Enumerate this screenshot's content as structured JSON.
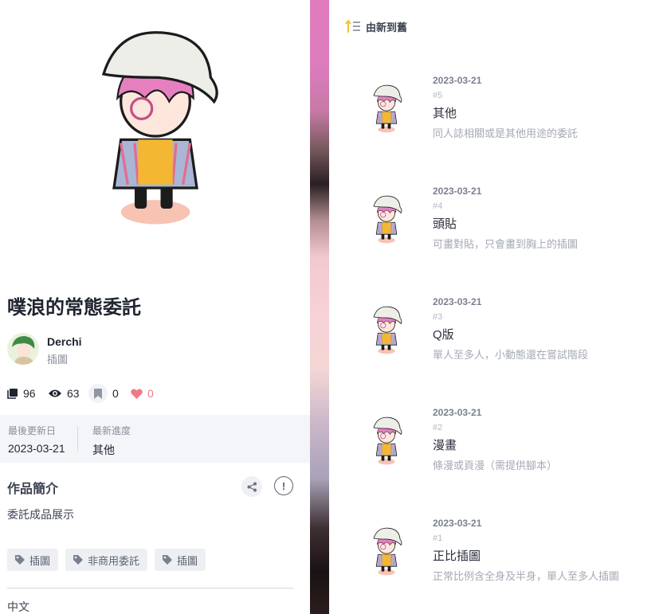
{
  "work": {
    "title": "噗浪的常態委託",
    "author_name": "Derchi",
    "author_role": "插圖",
    "stats": {
      "pages": "96",
      "views": "63",
      "bookmarks": "0",
      "likes": "0"
    },
    "last_update_label": "最後更新日",
    "last_update_value": "2023-03-21",
    "latest_progress_label": "最新進度",
    "latest_progress_value": "其他",
    "synopsis_title": "作品簡介",
    "synopsis": "委託成品展示",
    "report_symbol": "!",
    "tags": [
      "插圖",
      "非商用委託",
      "插圖"
    ],
    "language": "中文"
  },
  "chapters_panel": {
    "sort_label": "由新到舊",
    "chapters": [
      {
        "date": "2023-03-21",
        "number": "#5",
        "title": "其他",
        "desc": "同人誌相關或是其他用途的委託"
      },
      {
        "date": "2023-03-21",
        "number": "#4",
        "title": "頭貼",
        "desc": "可畫對貼，只會畫到胸上的插圖"
      },
      {
        "date": "2023-03-21",
        "number": "#3",
        "title": "Q版",
        "desc": "單人至多人，小動態還在嘗試階段"
      },
      {
        "date": "2023-03-21",
        "number": "#2",
        "title": "漫畫",
        "desc": "條漫或頁漫（需提供腳本）"
      },
      {
        "date": "2023-03-21",
        "number": "#1",
        "title": "正比插圖",
        "desc": "正常比例含全身及半身，單人至多人插圖"
      }
    ]
  },
  "colors": {
    "accent_hair": "#e67fc0",
    "hat": "#eeeee8",
    "shirt": "#f4b731",
    "like_heart": "#f07b86",
    "sort_arrow": "#f4c33c"
  },
  "icons": {
    "pages": "pages-icon",
    "views": "eye-icon",
    "bookmark": "bookmark-icon",
    "likes": "heart-icon",
    "share": "share-icon",
    "report": "report-icon",
    "tag": "tag-icon",
    "sort": "sort-icon"
  }
}
